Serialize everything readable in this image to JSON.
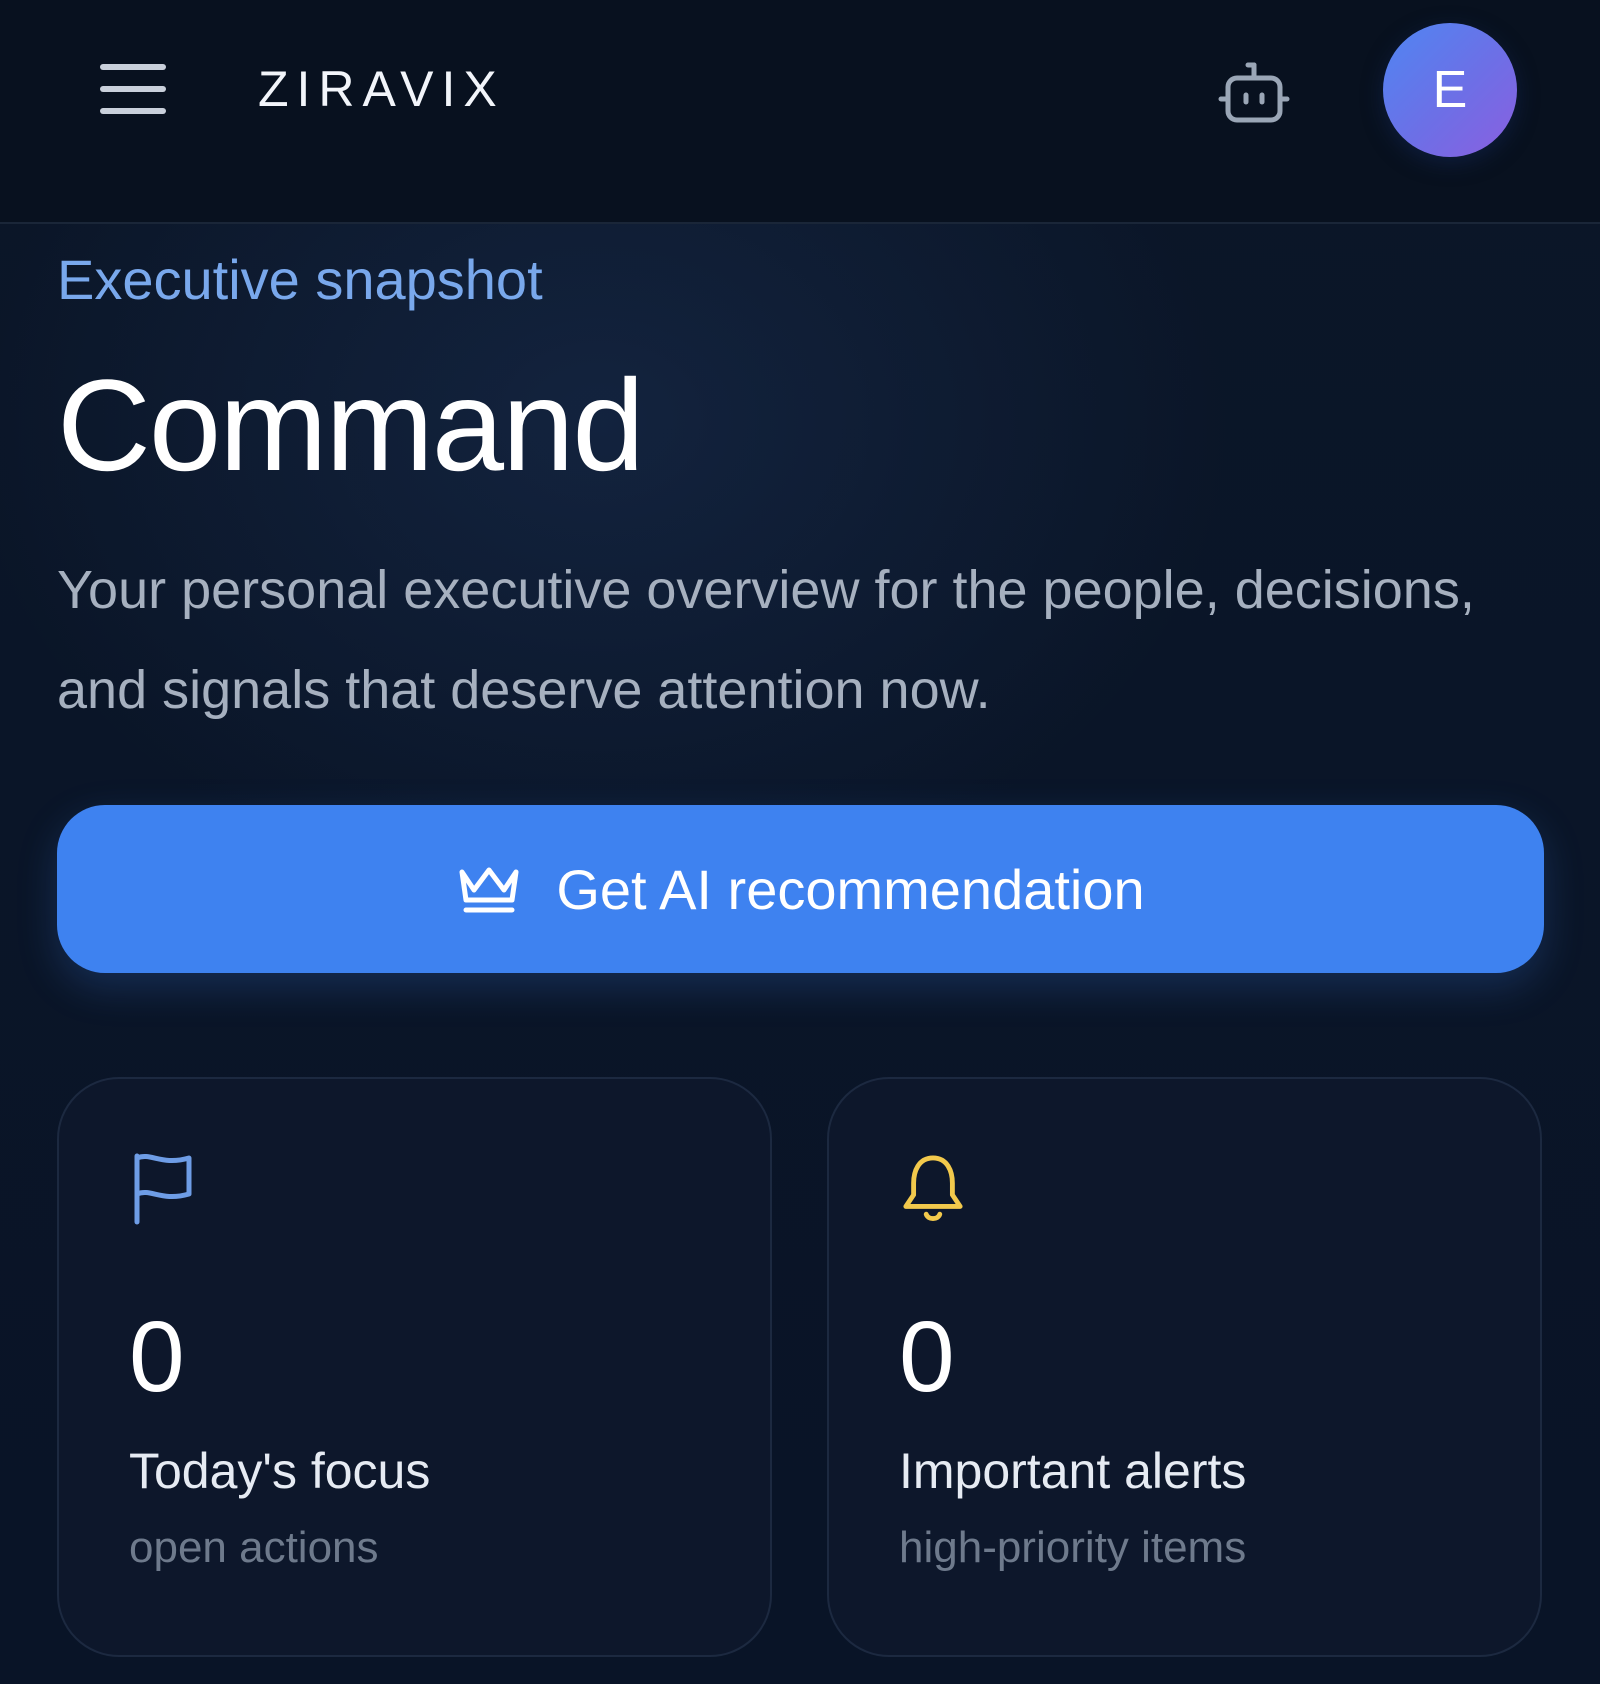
{
  "header": {
    "brand": "ZIRAVIX",
    "avatar_initial": "E",
    "menu_icon": "hamburger-menu-icon",
    "assistant_icon": "robot-icon"
  },
  "hero": {
    "eyebrow": "Executive snapshot",
    "title": "Command",
    "description": "Your personal executive overview for the people, decisions, and signals that deserve attention now."
  },
  "cta": {
    "label": "Get AI recommendation",
    "icon": "crown-icon"
  },
  "cards": [
    {
      "icon": "flag-icon",
      "value": "0",
      "label": "Today's focus",
      "sub": "open actions"
    },
    {
      "icon": "bell-icon",
      "value": "0",
      "label": "Important alerts",
      "sub": "high-priority items"
    }
  ],
  "colors": {
    "background": "#091427",
    "topbar": "#08111f",
    "accent": "#3e82f0",
    "eyebrow": "#79a8ec",
    "flag_icon": "#6e9de6",
    "bell_icon": "#f2c94c"
  }
}
